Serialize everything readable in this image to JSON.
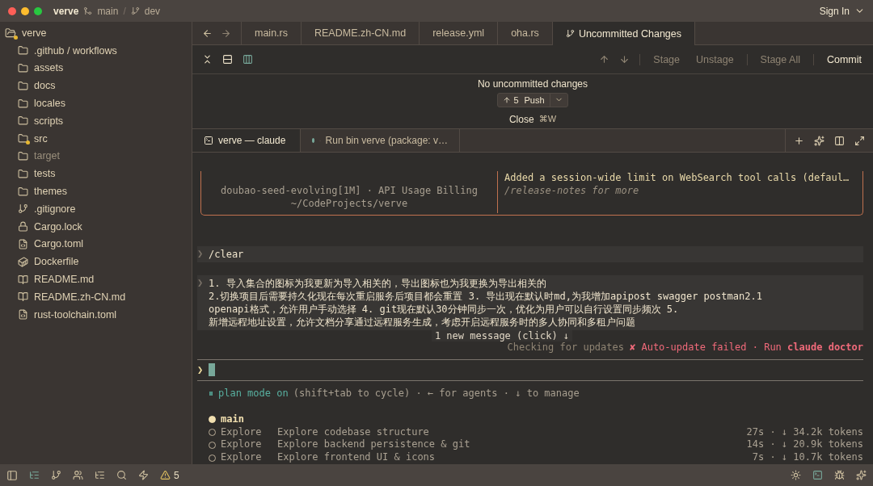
{
  "titlebar": {
    "project": "verve",
    "repo_branch": "main",
    "separator": "/",
    "branch": "dev",
    "sign_in": "Sign In"
  },
  "sidebar": {
    "root": {
      "label": "verve",
      "modified": true
    },
    "items": [
      {
        "label": ".github / workflows",
        "kind": "folder",
        "modified": false,
        "ignored": false
      },
      {
        "label": "assets",
        "kind": "folder",
        "modified": false,
        "ignored": false
      },
      {
        "label": "docs",
        "kind": "folder",
        "modified": false,
        "ignored": false
      },
      {
        "label": "locales",
        "kind": "folder",
        "modified": false,
        "ignored": false
      },
      {
        "label": "scripts",
        "kind": "folder",
        "modified": false,
        "ignored": false
      },
      {
        "label": "src",
        "kind": "folder",
        "modified": true,
        "ignored": false
      },
      {
        "label": "target",
        "kind": "folder",
        "modified": false,
        "ignored": true
      },
      {
        "label": "tests",
        "kind": "folder",
        "modified": false,
        "ignored": false
      },
      {
        "label": "themes",
        "kind": "folder",
        "modified": false,
        "ignored": false
      },
      {
        "label": ".gitignore",
        "kind": "git",
        "modified": false,
        "ignored": false
      },
      {
        "label": "Cargo.lock",
        "kind": "lock",
        "modified": false,
        "ignored": false
      },
      {
        "label": "Cargo.toml",
        "kind": "toml",
        "modified": false,
        "ignored": false
      },
      {
        "label": "Dockerfile",
        "kind": "docker",
        "modified": false,
        "ignored": false
      },
      {
        "label": "README.md",
        "kind": "book",
        "modified": false,
        "ignored": false
      },
      {
        "label": "README.zh-CN.md",
        "kind": "book",
        "modified": false,
        "ignored": false
      },
      {
        "label": "rust-toolchain.toml",
        "kind": "toml",
        "modified": false,
        "ignored": false
      }
    ]
  },
  "tabs": [
    {
      "label": "main.rs",
      "kind": "file",
      "selected": false
    },
    {
      "label": "README.zh-CN.md",
      "kind": "file",
      "selected": false
    },
    {
      "label": "release.yml",
      "kind": "file",
      "selected": false
    },
    {
      "label": "oha.rs",
      "kind": "file",
      "selected": false
    },
    {
      "label": "Uncommitted Changes",
      "kind": "git",
      "selected": true
    }
  ],
  "git_toolbar": {
    "buttons": [
      {
        "label": "Stage",
        "disabled": true
      },
      {
        "label": "Unstage",
        "disabled": true
      },
      {
        "label": "Stage All",
        "disabled": true
      },
      {
        "label": "Commit",
        "disabled": false
      }
    ]
  },
  "git_panel": {
    "message": "No uncommitted changes",
    "push": {
      "count": "5",
      "label": "Push"
    },
    "close": {
      "label": "Close",
      "shortcut": "⌘W"
    }
  },
  "terminal_tabs": [
    {
      "label": "verve — claude",
      "kind": "terminal",
      "selected": true
    },
    {
      "label": "Run bin verve (package: v…",
      "kind": "task",
      "selected": false
    }
  ],
  "terminal": {
    "banner": {
      "left": [
        "doubao-seed-evolving[1M] · API Usage Billing",
        "~/CodeProjects/verve"
      ],
      "news": "Added a session-wide limit on WebSearch tool calls (defaul…",
      "note": "/release-notes for more"
    },
    "messages": [
      {
        "marker": "❯",
        "lines": [
          "/clear"
        ]
      },
      {
        "marker": "❯",
        "lines": [
          "1. 导入集合的图标为我更新为导入相关的，导出图标也为我更换为导出相关的",
          "2.切换项目后需要持久化现在每次重启服务后项目都会重置 3. 导出现在默认时md,为我增加apipost swagger postman2.1",
          "openapi格式，允许用户手动选择 4. git现在默认30分钟同步一次，优化为用户可以自行设置同步频次 5.",
          "新增远程地址设置，允许文档分享通过远程服务生成，考虑开启远程服务时的多人协同和多租户问题"
        ]
      }
    ],
    "new_message": "1 new message (click) ↓",
    "update_check": "Checking for updates",
    "update_error": "✘ Auto-update failed · Run **claude doctor**",
    "prompt": "❯",
    "mode": {
      "icon": "⏸",
      "label": "plan mode on",
      "hint": "(shift+tab to cycle) · ← for agents · ↓ to manage"
    },
    "agents": {
      "main": "main",
      "tasks": [
        {
          "type": "Explore",
          "description": "Explore codebase structure",
          "stats": "27s · ↓ 34.2k tokens"
        },
        {
          "type": "Explore",
          "description": "Explore backend persistence & git",
          "stats": "14s · ↓ 20.9k tokens"
        },
        {
          "type": "Explore",
          "description": "Explore frontend UI & icons",
          "stats": "7s · ↓ 10.7k tokens"
        }
      ]
    }
  },
  "status_bar": {
    "warnings": "5"
  }
}
